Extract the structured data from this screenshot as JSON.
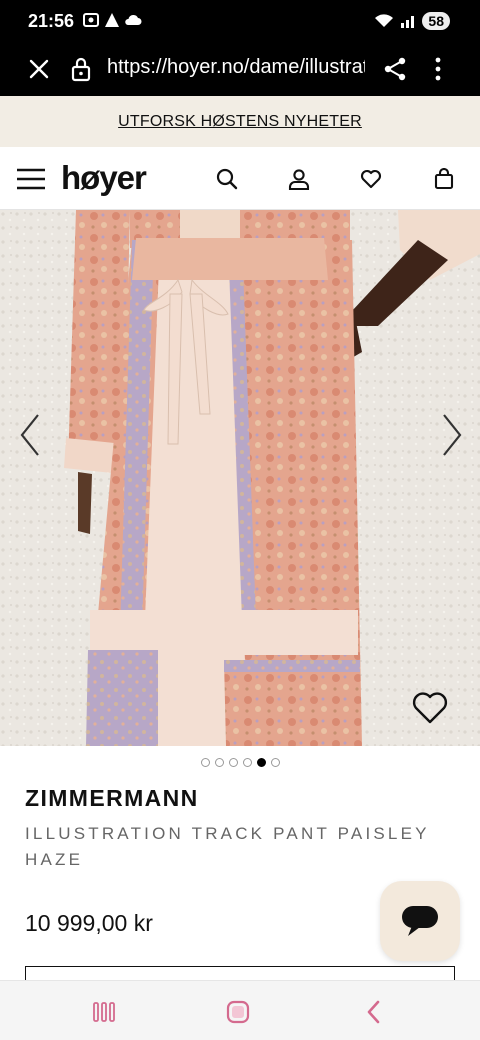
{
  "status_bar": {
    "time": "21:56",
    "battery": "58"
  },
  "browser": {
    "url": "https://hoyer.no/dame/illustration-track-pant"
  },
  "promo": {
    "text": "UTFORSK HØSTENS NYHETER"
  },
  "header": {
    "logo": "høyer"
  },
  "carousel": {
    "slide_count": 6,
    "active_index": 4
  },
  "product": {
    "brand": "ZIMMERMANN",
    "name": "ILLUSTRATION TRACK PANT PAISLEY HAZE",
    "price": "10 999,00 kr"
  },
  "colors": {
    "promo_bg": "#f2ede4",
    "chat_bg": "#f3e9dc",
    "text": "#111111",
    "subtle_text": "#666666"
  },
  "icons": [
    "close-icon",
    "lock-icon",
    "share-icon",
    "more-vert-icon",
    "menu-icon",
    "search-icon",
    "account-icon",
    "heart-icon",
    "bag-icon",
    "chevron-left-icon",
    "chevron-right-icon",
    "chat-icon",
    "recents-icon",
    "home-icon",
    "back-icon"
  ]
}
